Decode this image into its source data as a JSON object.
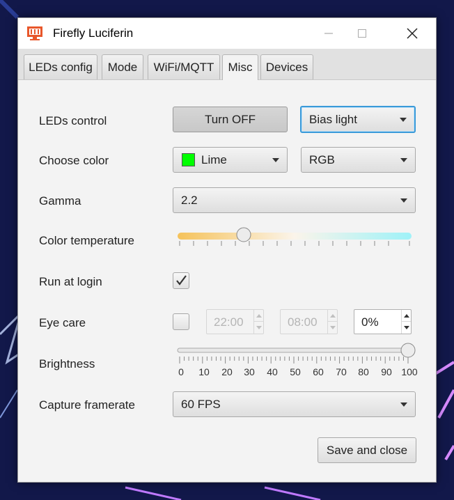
{
  "window": {
    "title": "Firefly Luciferin"
  },
  "tabs": [
    "LEDs config",
    "Mode",
    "WiFi/MQTT",
    "Misc",
    "Devices"
  ],
  "active_tab": "Misc",
  "settings": {
    "leds_control": {
      "label": "LEDs control",
      "button": "Turn OFF",
      "mode": "Bias light"
    },
    "choose_color": {
      "label": "Choose color",
      "color": "Lime",
      "color_hex": "#00ff00",
      "format": "RGB"
    },
    "gamma": {
      "label": "Gamma",
      "value": "2.2"
    },
    "color_temperature": {
      "label": "Color temperature",
      "level": 0.28
    },
    "run_at_login": {
      "label": "Run at login",
      "checked": true
    },
    "eye_care": {
      "label": "Eye care",
      "checked": false,
      "start": "22:00",
      "end": "08:00",
      "percent": "0%"
    },
    "brightness": {
      "label": "Brightness",
      "value": 100,
      "ticks": [
        "0",
        "10",
        "20",
        "30",
        "40",
        "50",
        "60",
        "70",
        "80",
        "90",
        "100"
      ]
    },
    "capture_framerate": {
      "label": "Capture framerate",
      "value": "60 FPS"
    }
  },
  "footer": {
    "save_label": "Save and close"
  },
  "icons": {
    "app": "firefly-logo-icon",
    "minimize": "minimize-icon",
    "maximize": "maximize-icon",
    "close": "close-icon",
    "check": "check-icon"
  },
  "colors": {
    "app_icon": "#e8572b",
    "focus": "#3a9ad9"
  }
}
